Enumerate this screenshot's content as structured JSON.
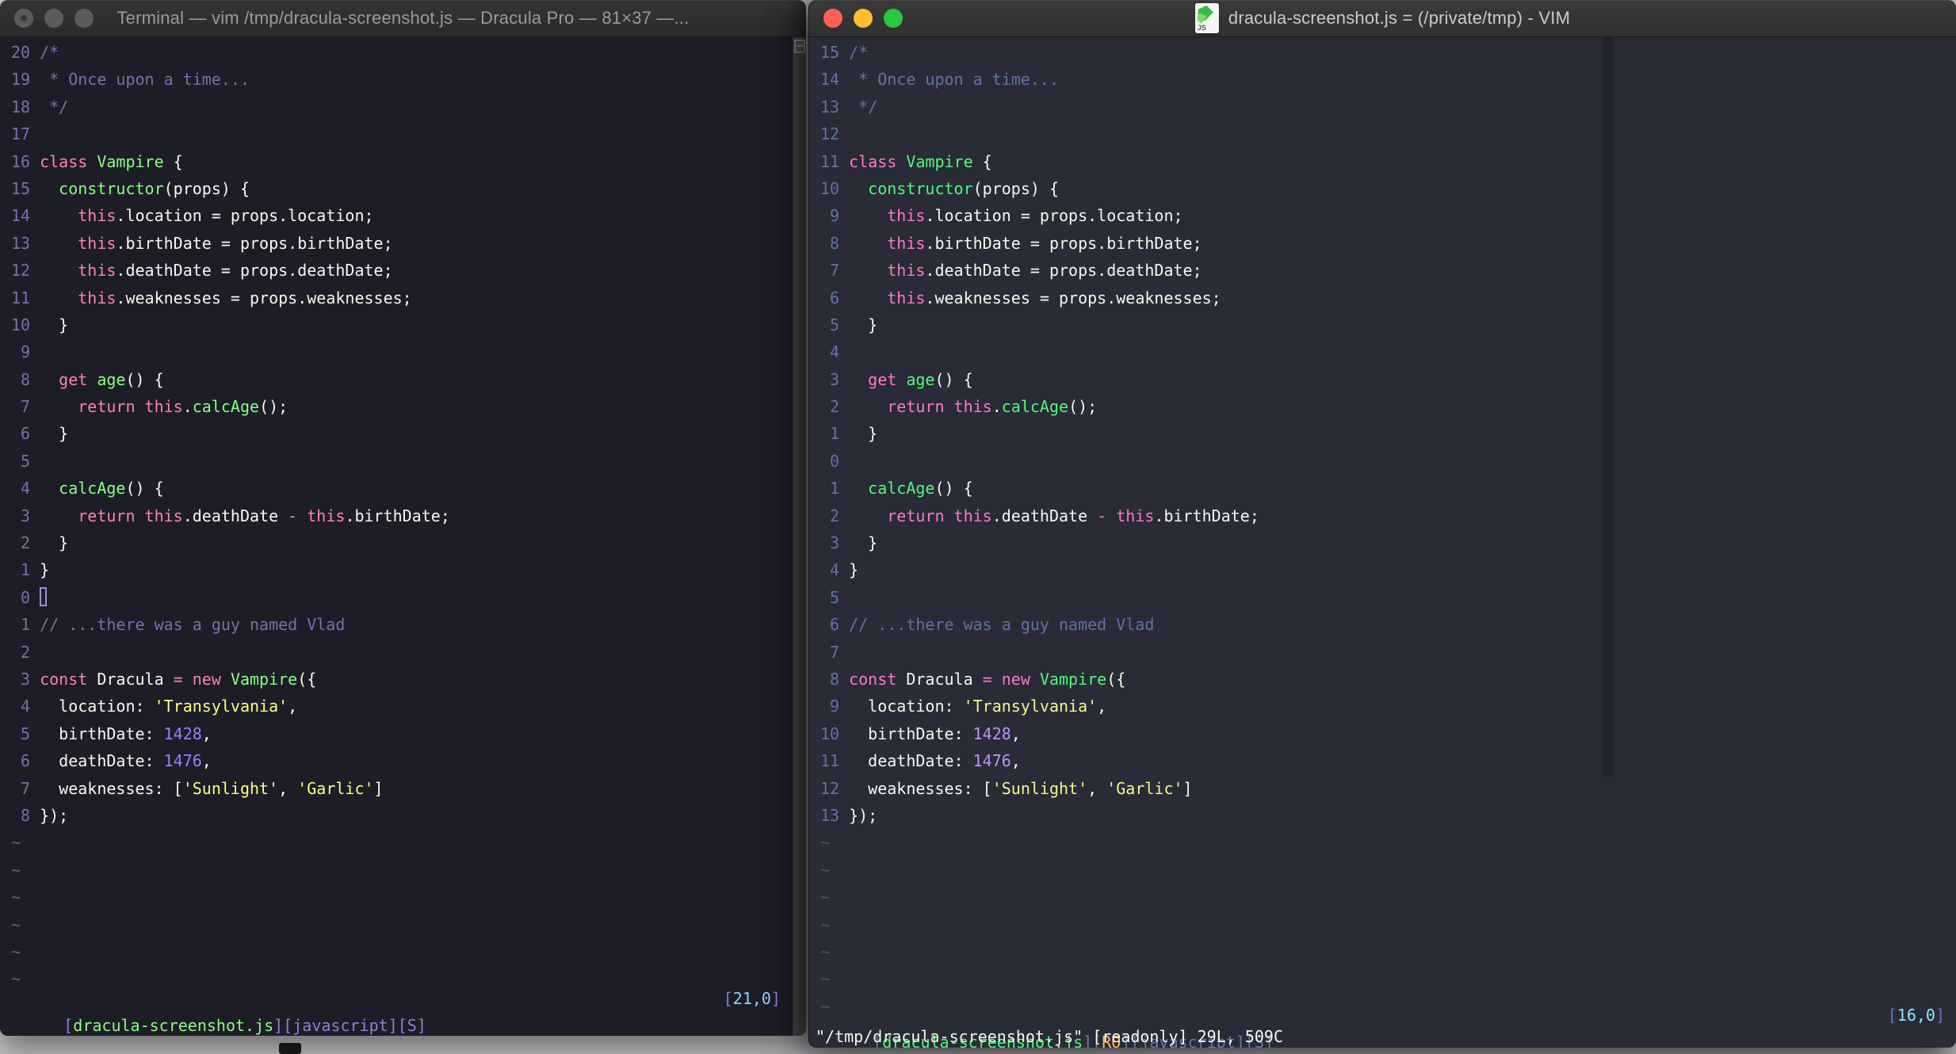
{
  "desktop": {
    "bg_color": "#C7C8CA"
  },
  "code_lines": [
    [
      [
        "com",
        "/*"
      ]
    ],
    [
      [
        "com",
        " * Once upon a time..."
      ]
    ],
    [
      [
        "com",
        " */"
      ]
    ],
    [],
    [
      [
        "kw",
        "class"
      ],
      [
        "fg",
        " "
      ],
      [
        "fn",
        "Vampire"
      ],
      [
        "fg",
        " {"
      ]
    ],
    [
      [
        "fg",
        "  "
      ],
      [
        "fn",
        "constructor"
      ],
      [
        "fg",
        "(props) {"
      ]
    ],
    [
      [
        "fg",
        "    "
      ],
      [
        "kw",
        "this"
      ],
      [
        "fg",
        ".location = props.location;"
      ]
    ],
    [
      [
        "fg",
        "    "
      ],
      [
        "kw",
        "this"
      ],
      [
        "fg",
        ".birthDate = props.birthDate;"
      ]
    ],
    [
      [
        "fg",
        "    "
      ],
      [
        "kw",
        "this"
      ],
      [
        "fg",
        ".deathDate = props.deathDate;"
      ]
    ],
    [
      [
        "fg",
        "    "
      ],
      [
        "kw",
        "this"
      ],
      [
        "fg",
        ".weaknesses = props.weaknesses;"
      ]
    ],
    [
      [
        "fg",
        "  }"
      ]
    ],
    [],
    [
      [
        "fg",
        "  "
      ],
      [
        "kw",
        "get"
      ],
      [
        "fg",
        " "
      ],
      [
        "fn",
        "age"
      ],
      [
        "fg",
        "() {"
      ]
    ],
    [
      [
        "fg",
        "    "
      ],
      [
        "kw",
        "return"
      ],
      [
        "fg",
        " "
      ],
      [
        "kw",
        "this"
      ],
      [
        "fg",
        "."
      ],
      [
        "fn",
        "calcAge"
      ],
      [
        "fg",
        "();"
      ]
    ],
    [
      [
        "fg",
        "  }"
      ]
    ],
    [],
    [
      [
        "fg",
        "  "
      ],
      [
        "fn",
        "calcAge"
      ],
      [
        "fg",
        "() {"
      ]
    ],
    [
      [
        "fg",
        "    "
      ],
      [
        "kw",
        "return"
      ],
      [
        "fg",
        " "
      ],
      [
        "kw",
        "this"
      ],
      [
        "fg",
        ".deathDate "
      ],
      [
        "op",
        "-"
      ],
      [
        "fg",
        " "
      ],
      [
        "kw",
        "this"
      ],
      [
        "fg",
        ".birthDate;"
      ]
    ],
    [
      [
        "fg",
        "  }"
      ]
    ],
    [
      [
        "fg",
        "}"
      ]
    ],
    [],
    [
      [
        "com",
        "// ...there was a guy named Vlad"
      ]
    ],
    [],
    [
      [
        "kw",
        "const"
      ],
      [
        "fg",
        " Dracula "
      ],
      [
        "op",
        "="
      ],
      [
        "fg",
        " "
      ],
      [
        "kw",
        "new"
      ],
      [
        "fg",
        " "
      ],
      [
        "fn",
        "Vampire"
      ],
      [
        "fg",
        "({"
      ]
    ],
    [
      [
        "fg",
        "  location: "
      ],
      [
        "str",
        "'Transylvania'"
      ],
      [
        "fg",
        ","
      ]
    ],
    [
      [
        "fg",
        "  birthDate: "
      ],
      [
        "num",
        "1428"
      ],
      [
        "fg",
        ","
      ]
    ],
    [
      [
        "fg",
        "  deathDate: "
      ],
      [
        "num",
        "1476"
      ],
      [
        "fg",
        ","
      ]
    ],
    [
      [
        "fg",
        "  weaknesses: ["
      ],
      [
        "str",
        "'Sunlight'"
      ],
      [
        "fg",
        ", "
      ],
      [
        "str",
        "'Garlic'"
      ],
      [
        "fg",
        "]"
      ]
    ],
    [
      [
        "fg",
        "});"
      ]
    ]
  ],
  "left_window": {
    "title": "Terminal — vim /tmp/dracula-screenshot.js — Dracula Pro — 81×37 —...",
    "theme_name": "Dracula Pro",
    "terminal_size": "81×37",
    "cursor_row": 21,
    "cursor_style": "hollow",
    "tilde_count": 6,
    "rel_numbers": [
      "20",
      "19",
      "18",
      "17",
      "16",
      "15",
      "14",
      "13",
      "12",
      "11",
      "10",
      "9",
      "8",
      "7",
      "6",
      "5",
      "4",
      "3",
      "2",
      "1",
      "0",
      "1",
      "2",
      "3",
      "4",
      "5",
      "6",
      "7",
      "8"
    ],
    "status_segments": [
      [
        "bracket",
        "["
      ],
      [
        "file",
        "dracula-screenshot.js"
      ],
      [
        "bracket",
        "]["
      ],
      [
        "mode",
        "javascript"
      ],
      [
        "bracket",
        "]["
      ],
      [
        "mode",
        "S"
      ],
      [
        "bracket",
        "]"
      ]
    ],
    "ruler_segments": [
      [
        "bracket",
        "["
      ],
      [
        "rnum",
        "21,0"
      ],
      [
        "bracket",
        "]"
      ]
    ],
    "theme": {
      "bg": "#1c1d27",
      "fg": "#f8f8f2",
      "com": "#7970a9",
      "kw": "#ff80bf",
      "fn": "#8aff80",
      "str": "#ffff80",
      "num": "#9580ff",
      "op": "#ff80bf",
      "ln": "#7970a9",
      "tilde": "#60607a",
      "bracket": "#8a82d0",
      "file": "#8aff80",
      "mode": "#8a82d0",
      "ro": "#ffca80",
      "rnum": "#8bd5fa",
      "cursor": "#9a91d8",
      "cc": "#1c1d27"
    }
  },
  "right_window": {
    "title": "dracula-screenshot.js = (/private/tmp) - VIM",
    "icon_label": "JS",
    "theme_name": "Dracula",
    "cursor_row": 16,
    "cursor_style": "none",
    "tilde_count": 7,
    "rel_numbers": [
      "15",
      "14",
      "13",
      "12",
      "11",
      "10",
      "9",
      "8",
      "7",
      "6",
      "5",
      "4",
      "3",
      "2",
      "1",
      "0",
      "1",
      "2",
      "3",
      "4",
      "5",
      "6",
      "7",
      "8",
      "9",
      "10",
      "11",
      "12",
      "13"
    ],
    "status_segments": [
      [
        "bracket",
        "["
      ],
      [
        "file",
        "dracula-screenshot.js"
      ],
      [
        "bracket",
        "]["
      ],
      [
        "ro",
        "RO"
      ],
      [
        "bracket",
        "]["
      ],
      [
        "mode",
        "javascript"
      ],
      [
        "bracket",
        "]["
      ],
      [
        "mode",
        "S"
      ],
      [
        "bracket",
        "]"
      ]
    ],
    "ruler_segments": [
      [
        "bracket",
        "["
      ],
      [
        "rnum",
        "16,0"
      ],
      [
        "bracket",
        "]"
      ]
    ],
    "message_line": "\"/tmp/dracula-screenshot.js\" [readonly] 29L, 509C",
    "theme": {
      "bg": "#292b36",
      "fg": "#f8f8f2",
      "com": "#6272a4",
      "kw": "#ff79c6",
      "fn": "#50fa7b",
      "str": "#f1fa8c",
      "num": "#bd93f9",
      "op": "#ff79c6",
      "ln": "#6272a4",
      "tilde": "#4d5066",
      "bracket": "#6478b0",
      "file": "#50fa7b",
      "mode": "#6478b0",
      "ro": "#ffb86c",
      "rnum": "#8be9fd",
      "cursor": "#f8f8f2",
      "cc": "#21222c"
    }
  }
}
